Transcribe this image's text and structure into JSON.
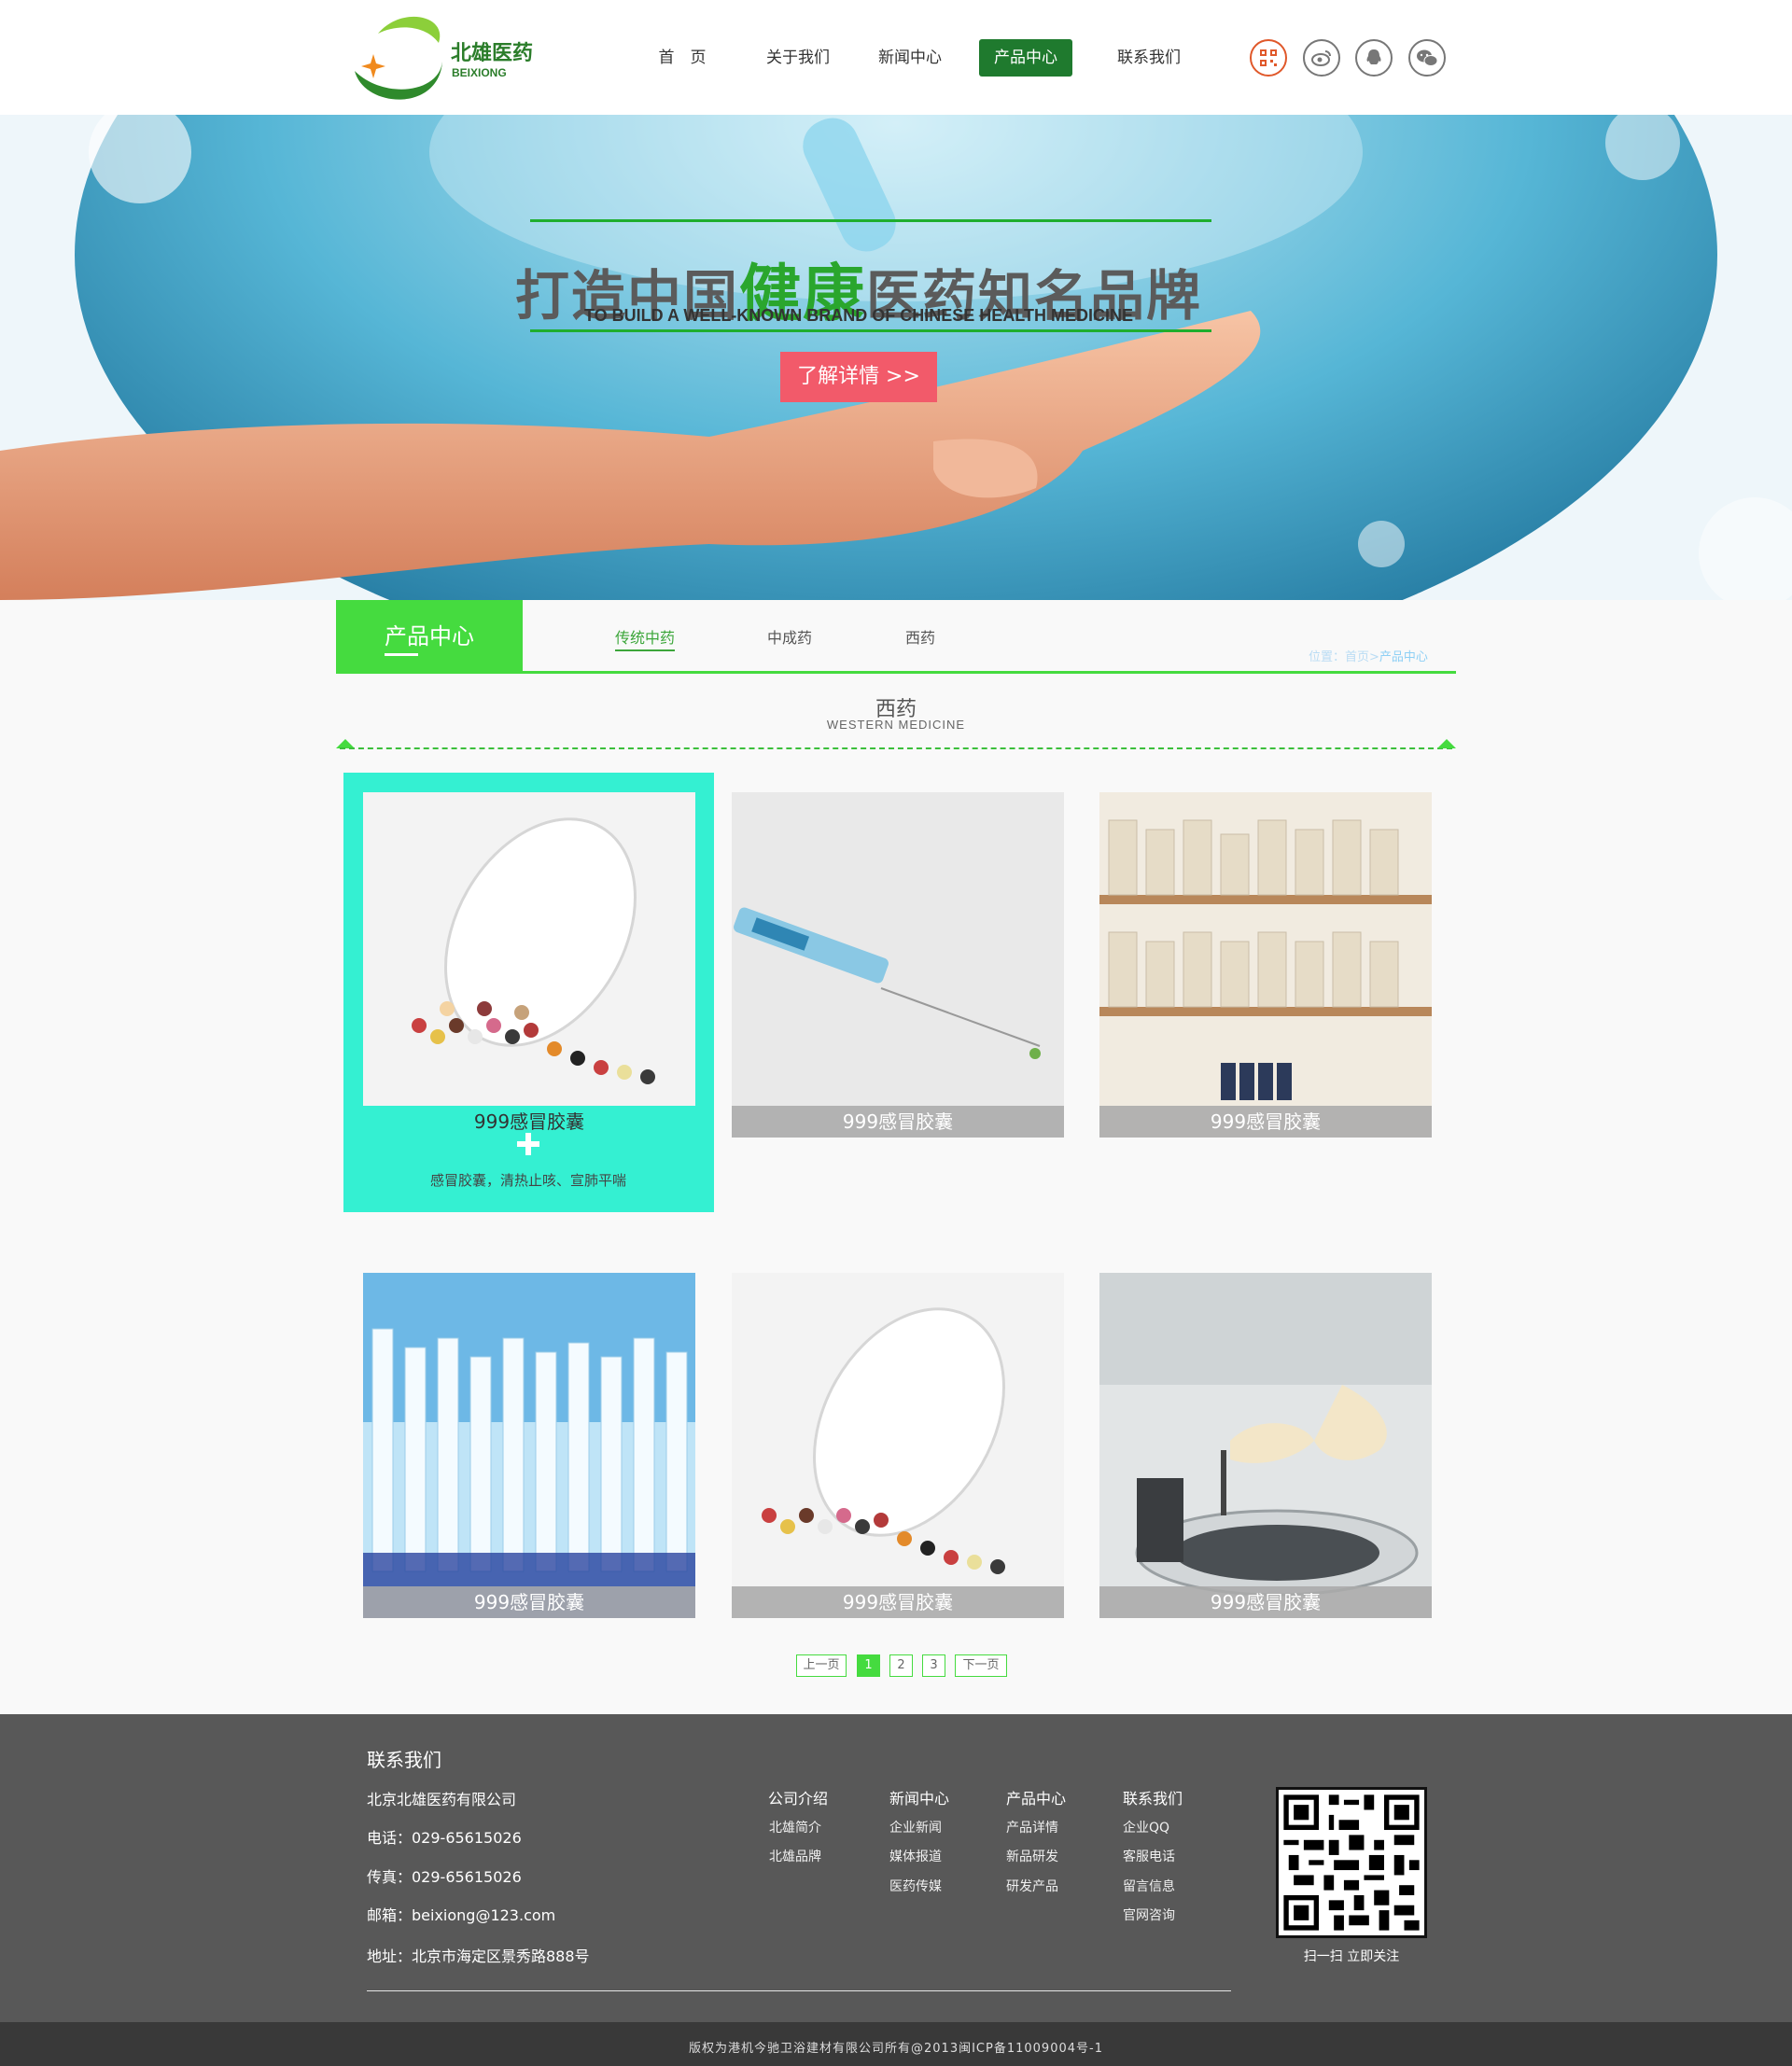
{
  "brand": {
    "name_cn": "北雄医药",
    "name_en": "BEIXIONG",
    "green": "#1f7a2e",
    "accent": "#45db3f"
  },
  "nav": {
    "items": [
      {
        "label": "首　页"
      },
      {
        "label": "关于我们"
      },
      {
        "label": "新闻中心"
      },
      {
        "label": "产品中心",
        "active": true
      },
      {
        "label": "联系我们"
      }
    ],
    "social_icons": [
      "qr-code-icon",
      "weibo-icon",
      "qq-icon",
      "wechat-icon"
    ]
  },
  "banner": {
    "title_pre": "打造中国",
    "title_hl": "健康",
    "title_post": "医药知名品牌",
    "subtitle": "TO BUILD A WELL-KNOWN BRAND OF CHINESE HEALTH MEDICINE",
    "button": "了解详情 >>"
  },
  "section": {
    "tab": "产品中心",
    "subnav": [
      "传统中药",
      "中成药",
      "西药"
    ],
    "breadcrumb": {
      "a": "位置：",
      "b": "首页>",
      "c": "产品中心"
    },
    "category_title": "西药",
    "category_sub": "WESTERN MEDICINE"
  },
  "products": [
    {
      "name": "999感冒胶囊",
      "image": "pills-jar",
      "active": true,
      "desc": "感冒胶囊，清热止咳、宣肺平喘"
    },
    {
      "name": "999感冒胶囊",
      "image": "syringe"
    },
    {
      "name": "999感冒胶囊",
      "image": "jars-shelf"
    },
    {
      "name": "999感冒胶囊",
      "image": "test-tubes"
    },
    {
      "name": "999感冒胶囊",
      "image": "pills-jar"
    },
    {
      "name": "999感冒胶囊",
      "image": "lab-centrifuge"
    }
  ],
  "pagination": {
    "prev": "上一页",
    "pages": [
      "1",
      "2",
      "3"
    ],
    "current": "1",
    "next": "下一页"
  },
  "footer": {
    "title": "联系我们",
    "company": "北京北雄医药有限公司",
    "phone": "电话：029-65615026",
    "fax": "传真：029-65615026",
    "email": "邮箱：beixiong@123.com",
    "address": "地址：北京市海定区景秀路888号",
    "columns": [
      {
        "title": "公司介绍",
        "items": [
          "北雄简介",
          "北雄品牌"
        ]
      },
      {
        "title": "新闻中心",
        "items": [
          "企业新闻",
          "媒体报道",
          "医药传媒"
        ]
      },
      {
        "title": "产品中心",
        "items": [
          "产品详情",
          "新品研发",
          "研发产品"
        ]
      },
      {
        "title": "联系我们",
        "items": [
          "企业QQ",
          "客服电话",
          "留言信息",
          "官网咨询"
        ]
      }
    ],
    "qr_caption": "扫一扫  立即关注",
    "copyright": "版权为港机今驰卫浴建材有限公司所有@2013闽ICP备11009004号-1"
  }
}
